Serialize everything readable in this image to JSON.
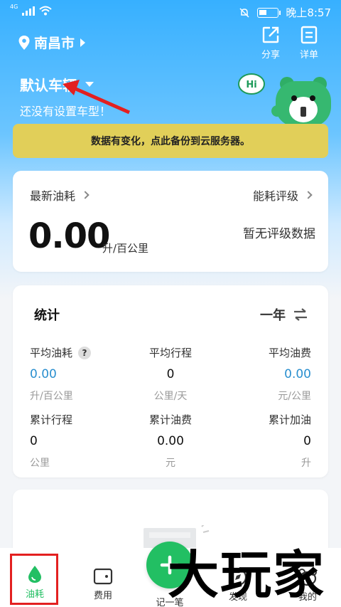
{
  "status_bar": {
    "network": "4G",
    "time": "晚上8:57"
  },
  "header": {
    "city": "南昌市",
    "share_label": "分享",
    "detail_label": "详单",
    "vehicle_name": "默认车辆",
    "vehicle_subtitle": "还没有设置车型！",
    "mascot_text": "Hi"
  },
  "banner": {
    "text": "数据有变化，点此备份到云服务器。"
  },
  "fuel_card": {
    "latest_label": "最新油耗",
    "rating_label": "能耗评级",
    "value": "0.00",
    "unit": "升/百公里",
    "no_rating": "暂无评级数据"
  },
  "stats_card": {
    "title": "统计",
    "period": "一年",
    "items": [
      {
        "label": "平均油耗",
        "value": "0.00",
        "unit": "升/百公里",
        "help": "?"
      },
      {
        "label": "平均行程",
        "value": "0",
        "unit": "公里/天"
      },
      {
        "label": "平均油费",
        "value": "0.00",
        "unit": "元/公里"
      },
      {
        "label": "累计行程",
        "value": "0",
        "unit": "公里"
      },
      {
        "label": "累计油费",
        "value": "0.00",
        "unit": "元"
      },
      {
        "label": "累计加油",
        "value": "0",
        "unit": "升"
      }
    ]
  },
  "tabbar": {
    "fuel": "油耗",
    "cost": "费用",
    "record": "记一笔",
    "discover": "发现",
    "mine": "我的"
  },
  "watermark": "大玩家",
  "colors": {
    "accent_blue": "#2a8fcf",
    "banner_yellow": "#e1cf59",
    "fab_green": "#22bf63",
    "annotation_red": "#e32020"
  }
}
